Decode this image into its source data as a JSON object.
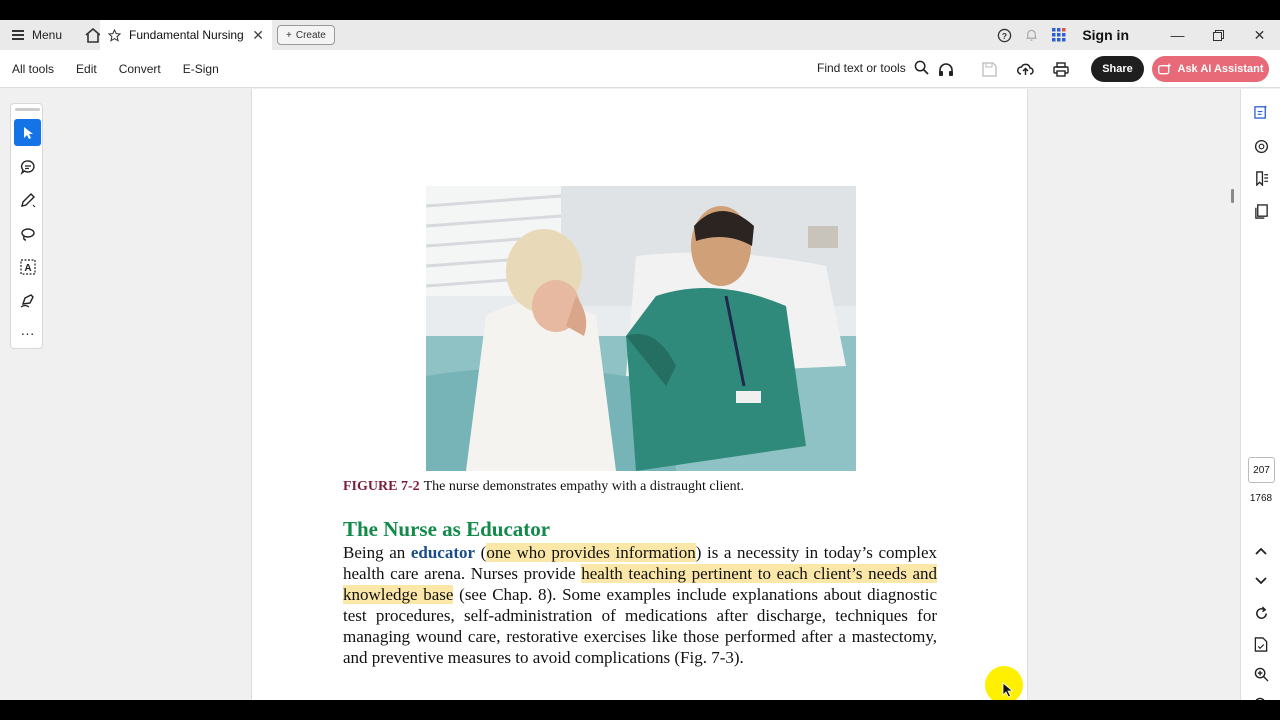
{
  "titlebar": {
    "menu_label": "Menu",
    "tab_title": "Fundamental Nursing Sk...",
    "create_label": "Create",
    "sign_in_label": "Sign in"
  },
  "toolbar": {
    "items": [
      "All tools",
      "Edit",
      "Convert",
      "E-Sign"
    ],
    "find_label": "Find text or tools",
    "share_label": "Share",
    "ai_label": "Ask AI Assistant"
  },
  "document": {
    "figure_label": "FIGURE 7-2",
    "figure_caption": "The nurse demonstrates empathy with a distraught client.",
    "section_heading": "The Nurse as Educator",
    "para_1": "Being an ",
    "keyword": "educator",
    "para_2": " (",
    "highlight_1": "one who provides information",
    "para_3": ") is a necessity in today’s complex health care arena. Nurses provide ",
    "highlight_2": "health teaching pertinent to each client’s needs and knowledge base",
    "para_4": " (see Chap. 8). Some examples include explanations about diagnostic test procedures, self-administration of medications after discharge, techniques for managing wound care, restorative exercises like those performed after a mastectomy, and preventive measures to avoid complications (Fig. 7-3)."
  },
  "navigation": {
    "current_page": "207",
    "total_pages": "1768"
  },
  "colors": {
    "accent": "#1473e6",
    "ai_button": "#e86a78",
    "heading_green": "#118a4a",
    "highlight": "#fbe7a8"
  }
}
